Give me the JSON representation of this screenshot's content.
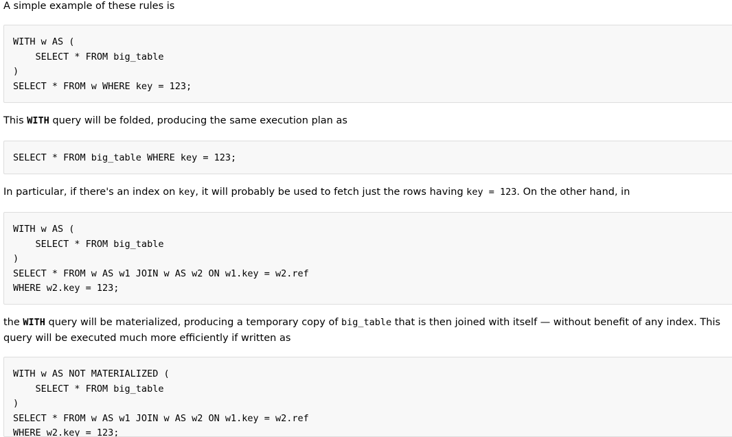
{
  "content": {
    "p1": "A simple example of these rules is",
    "code1": "WITH w AS (\n    SELECT * FROM big_table\n)\nSELECT * FROM w WHERE key = 123;",
    "p2": {
      "before": "This ",
      "kw": "WITH",
      "after": " query will be folded, producing the same execution plan as"
    },
    "code2": "SELECT * FROM big_table WHERE key = 123;",
    "p3": {
      "before": "In particular, if there's an index on ",
      "code_a": "key",
      "middle": ", it will probably be used to fetch just the rows having ",
      "code_b": "key = 123",
      "after": ". On the other hand, in"
    },
    "code3": "WITH w AS (\n    SELECT * FROM big_table\n)\nSELECT * FROM w AS w1 JOIN w AS w2 ON w1.key = w2.ref\nWHERE w2.key = 123;",
    "p4": {
      "before": "the ",
      "kw": "WITH",
      "middle": " query will be materialized, producing a temporary copy of ",
      "code_a": "big_table",
      "after": " that is then joined with itself — without benefit of any index. This query will be executed much more efficiently if written as"
    },
    "code4": "WITH w AS NOT MATERIALIZED (\n    SELECT * FROM big_table\n)\nSELECT * FROM w AS w1 JOIN w AS w2 ON w1.key = w2.ref\nWHERE w2.key = 123;"
  }
}
